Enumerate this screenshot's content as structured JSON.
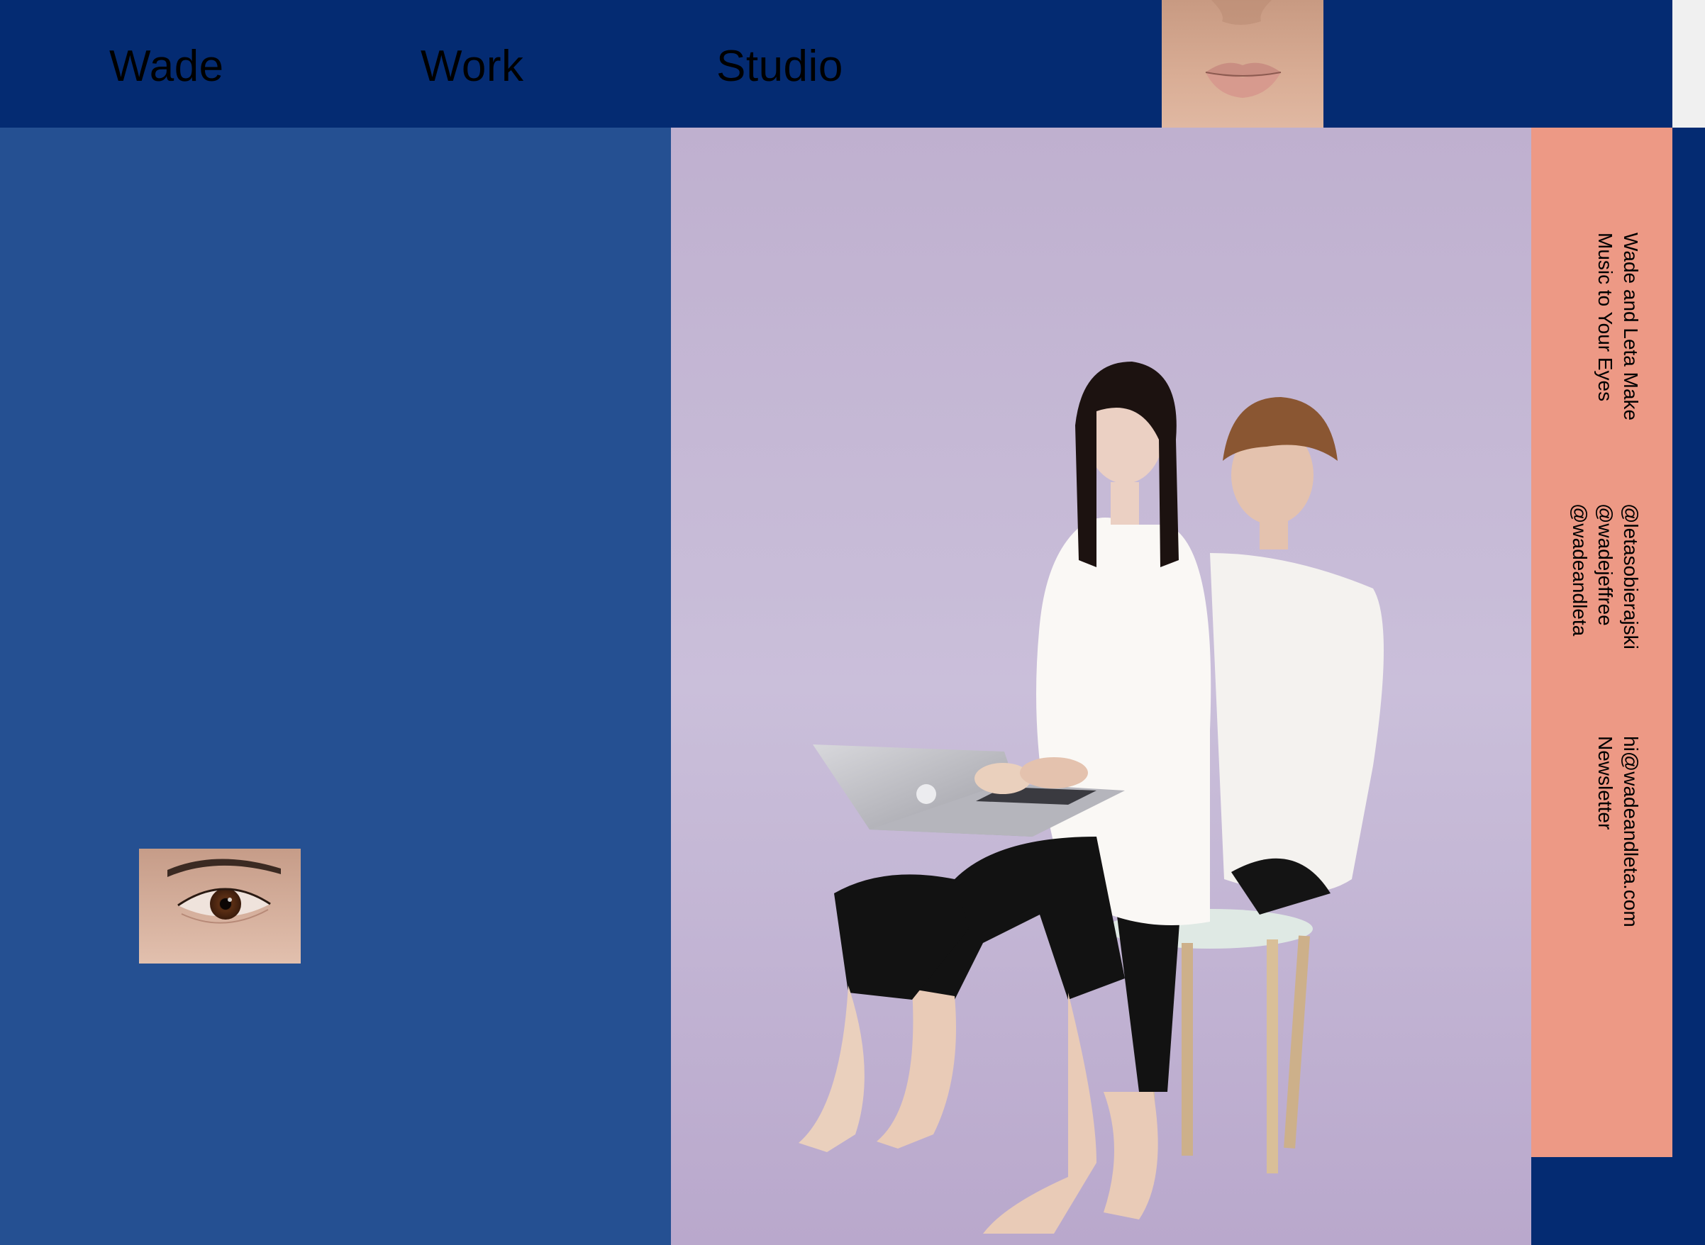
{
  "nav": {
    "brand": "Wade",
    "work": "Work",
    "studio": "Studio"
  },
  "sidebar": {
    "tagline_line1": "Wade and Leta Make",
    "tagline_line2": "Music to Your Eyes",
    "social": [
      "@letasobierajski",
      "@wadejeffree",
      "@wadeandleta"
    ],
    "email": "hi@wadeandleta.com",
    "newsletter": "Newsletter"
  },
  "colors": {
    "nav_bg": "#042b72",
    "left_panel": "#255092",
    "salmon": "#ed9985",
    "photo_bg": "#c4b6d3"
  },
  "images": {
    "mouth": "mouth-closeup",
    "eye": "eye-closeup",
    "hero": "couple-with-laptop-on-stool"
  }
}
